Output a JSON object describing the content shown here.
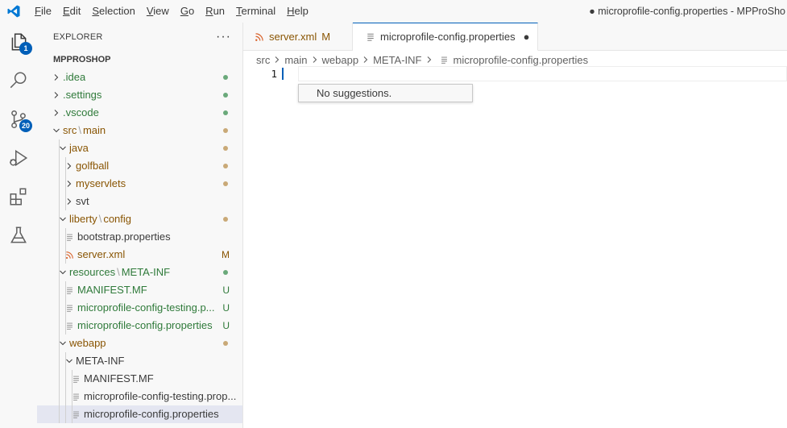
{
  "menubar": {
    "items": [
      {
        "u": "F",
        "rest": "ile"
      },
      {
        "u": "E",
        "rest": "dit"
      },
      {
        "u": "S",
        "rest": "election"
      },
      {
        "u": "V",
        "rest": "iew"
      },
      {
        "u": "G",
        "rest": "o"
      },
      {
        "u": "R",
        "rest": "un"
      },
      {
        "u": "T",
        "rest": "erminal"
      },
      {
        "u": "H",
        "rest": "elp"
      }
    ]
  },
  "window_title": "● microprofile-config.properties - MPProSho",
  "activity": {
    "explorer_badge": "1",
    "scm_badge": "20"
  },
  "sidebar": {
    "title": "EXPLORER",
    "more": "···",
    "root": "MPPROSHOP",
    "items": [
      {
        "label": ".idea",
        "deco": "dot-green"
      },
      {
        "label": ".settings",
        "deco": "dot-green"
      },
      {
        "label": ".vscode",
        "deco": "dot-green"
      },
      {
        "label": "src",
        "sep": "\\",
        "label2": "main",
        "deco": "dot-brown"
      },
      {
        "label": "java",
        "deco": "dot-brown"
      },
      {
        "label": "golfball",
        "deco": "dot-brown"
      },
      {
        "label": "myservlets",
        "deco": "dot-brown"
      },
      {
        "label": "svt",
        "deco": ""
      },
      {
        "label": "liberty",
        "sep": "\\",
        "label2": "config",
        "deco": "dot-brown"
      },
      {
        "label": "bootstrap.properties",
        "deco": ""
      },
      {
        "label": "server.xml",
        "deco": "M"
      },
      {
        "label": "resources",
        "sep": "\\",
        "label2": "META-INF",
        "deco": "dot-green"
      },
      {
        "label": "MANIFEST.MF",
        "deco": "U"
      },
      {
        "label": "microprofile-config-testing.p...",
        "deco": "U"
      },
      {
        "label": "microprofile-config.properties",
        "deco": "U"
      },
      {
        "label": "webapp",
        "deco": "dot-brown"
      },
      {
        "label": "META-INF",
        "deco": ""
      },
      {
        "label": "MANIFEST.MF",
        "deco": ""
      },
      {
        "label": "microprofile-config-testing.prop...",
        "deco": ""
      },
      {
        "label": "microprofile-config.properties",
        "deco": ""
      }
    ]
  },
  "tabs": [
    {
      "label": "server.xml",
      "status": "M",
      "active": false
    },
    {
      "label": "microprofile-config.properties",
      "status": "●",
      "active": true
    }
  ],
  "breadcrumb": [
    "src",
    "main",
    "webapp",
    "META-INF",
    "microprofile-config.properties"
  ],
  "editor": {
    "line_number": "1",
    "suggest_text": "No suggestions."
  },
  "colors": {
    "accent": "#005fb8",
    "git_added": "#2f7a3a",
    "git_modified": "#895503",
    "dot_green": "#6aa97a",
    "dot_brown": "#c9a977",
    "rss_orange": "#d9622b"
  }
}
